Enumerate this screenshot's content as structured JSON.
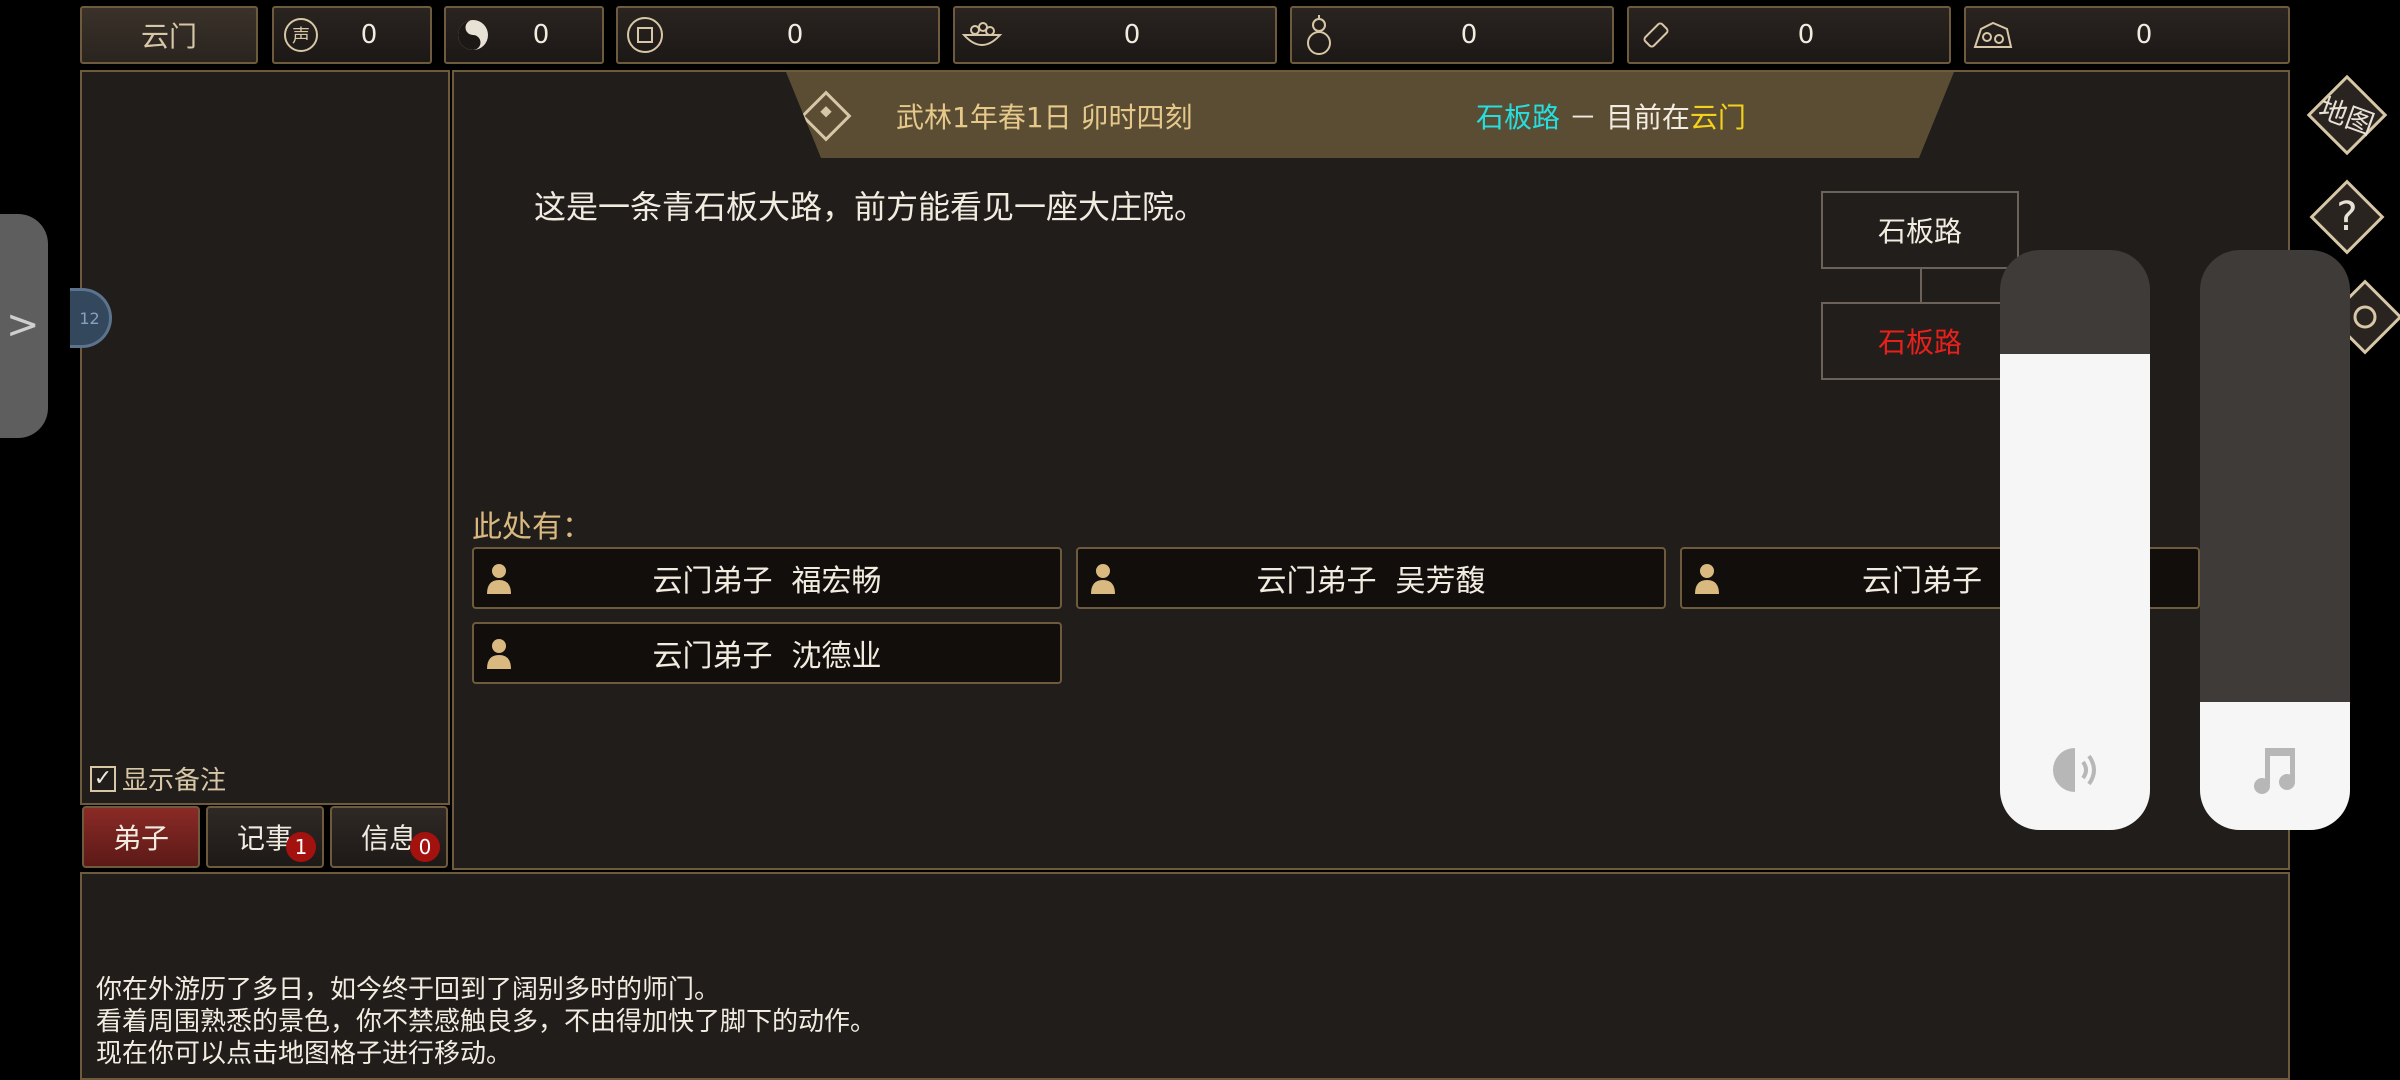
{
  "topbar": {
    "sect_name": "云门",
    "resources": [
      {
        "icon": "reputation-icon",
        "value": "0"
      },
      {
        "icon": "yin-yang-icon",
        "value": "0"
      },
      {
        "icon": "coin-icon",
        "value": "0"
      },
      {
        "icon": "food-bowl-icon",
        "value": "0"
      },
      {
        "icon": "gourd-icon",
        "value": "0"
      },
      {
        "icon": "scroll-icon",
        "value": "0"
      },
      {
        "icon": "ore-icon",
        "value": "0"
      }
    ]
  },
  "left_panel": {
    "show_notes_label": "显示备注",
    "show_notes_checked": true,
    "orb_text": "12",
    "tabs": [
      {
        "label": "弟子",
        "active": true,
        "badge": null
      },
      {
        "label": "记事",
        "active": false,
        "badge": "1"
      },
      {
        "label": "信息",
        "active": false,
        "badge": "0"
      }
    ]
  },
  "header": {
    "date": "武林1年春1日 卯时四刻",
    "location": "石板路",
    "separator": "－",
    "currently_at_prefix": "目前在",
    "currently_at_place": "云门"
  },
  "scene": {
    "description": "这是一条青石板大路，前方能看见一座大庄院。",
    "here_label": "此处有：",
    "npcs": [
      {
        "title": "云门弟子",
        "name": "福宏畅"
      },
      {
        "title": "云门弟子",
        "name": "吴芳馥"
      },
      {
        "title": "云门弟子",
        "name": ""
      },
      {
        "title": "云门弟子",
        "name": "沈德业"
      }
    ]
  },
  "minimap": {
    "cells": [
      {
        "label": "石板路",
        "current": false
      },
      {
        "label": "石板路",
        "current": true
      }
    ]
  },
  "volume": {
    "sound_level": 0.82,
    "music_level": 0.22
  },
  "right_icons": {
    "map_label": "地图",
    "help": "?"
  },
  "log": {
    "lines": [
      "你在外游历了多日，如今终于回到了阔别多时的师门。",
      "看着周围熟悉的景色，你不禁感触良多，不由得加快了脚下的动作。",
      "现在你可以点击地图格子进行移动。"
    ]
  },
  "colors": {
    "border": "#6e5a3c",
    "panel": "#211d1b",
    "banner": "#5a4d34",
    "cyan": "#26dede",
    "yellow": "#f4d21c",
    "red": "#e8201c",
    "gold_text": "#d9b97f"
  }
}
